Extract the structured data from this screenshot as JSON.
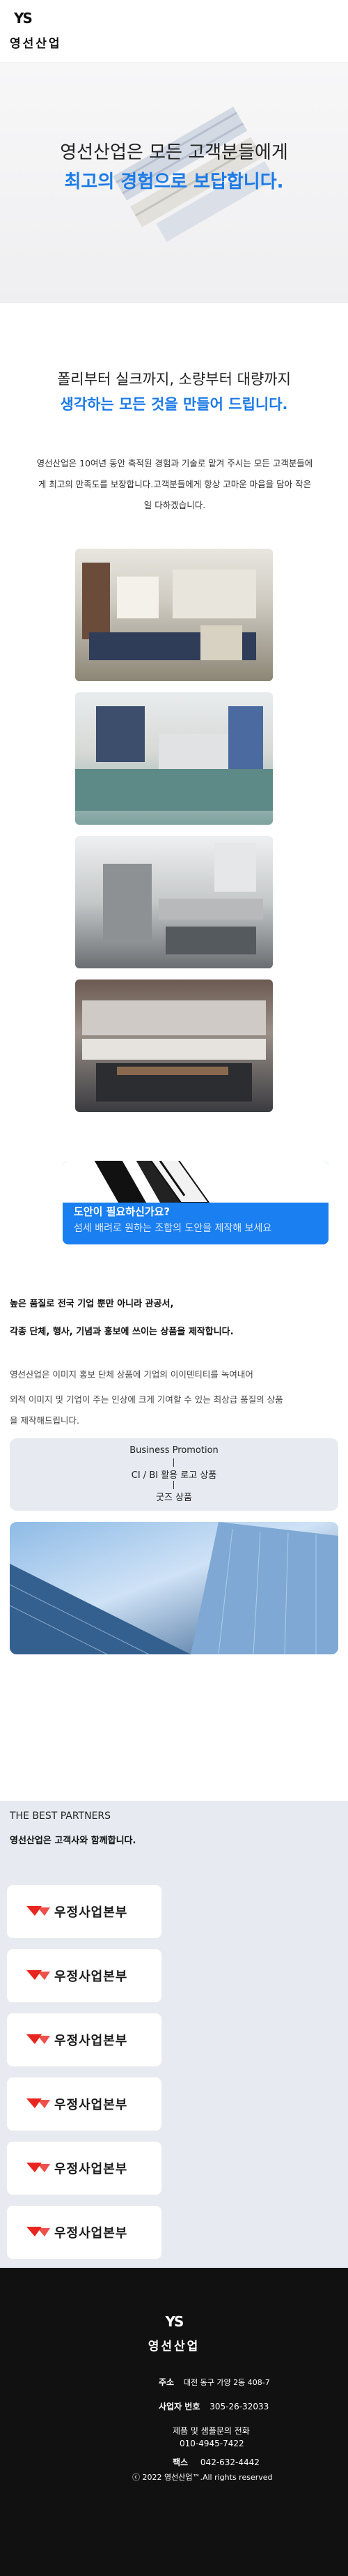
{
  "header": {
    "logo_mark": "YS",
    "company_name": "영선산업"
  },
  "hero": {
    "line1": "영선산업은 모든 고객분들에게",
    "line2": "최고의 경험으로 보답합니다."
  },
  "intro": {
    "line1": "폴리부터 실크까지, 소량부터 대량까지",
    "line2": "생각하는 모든 것을 만들어 드립니다.",
    "para1": "영선산업은 10여년 동안 축적된 경험과 기술로 맡겨 주시는 모든 고객분들에",
    "para2": "게 최고의 만족도를 보장합니다.고객분들에게 항상 고마운 마음을 담아 작은",
    "para3": "일 다하겠습니다."
  },
  "cta": {
    "question": "도안이 필요하신가요?",
    "desc": "섬세 배려로 원하는 조합의 도안을 제작해 보세요"
  },
  "promo": {
    "line1": "높은 품질로 전국 기업 뿐만 아니라 관공서,",
    "line2": "각종 단체, 행사, 기념과 홍보에 쓰이는 상품을 제작합니다.",
    "para1": "영선산업은 이미지 홍보 단체 상품에 기업의 이이덴티티를 녹여내어",
    "para2": "외적 이미지 및 기업이 주는 인상에 크게 기여할 수 있는 최상급 품질의 상품",
    "para3": "을 제작해드립니다."
  },
  "diagram": {
    "top": "Business Promotion",
    "middle": "CI / BI 활용 로고 상품",
    "bottom": "굿즈 상품"
  },
  "partners": {
    "title": "THE BEST PARTNERS",
    "subtitle": "영선산업은 고객사와 함께합니다.",
    "items": [
      {
        "name": "우정사업본부"
      },
      {
        "name": "우정사업본부"
      },
      {
        "name": "우정사업본부"
      },
      {
        "name": "우정사업본부"
      },
      {
        "name": "우정사업본부"
      },
      {
        "name": "우정사업본부"
      }
    ]
  },
  "footer": {
    "logo_mark": "YS",
    "company_name": "영선산업",
    "address_label": "주소",
    "address_value": "대전 동구 가양 2동 408-7",
    "biz_label": "사업자 번호",
    "biz_value": "305-26-32033",
    "phone_label": "제품 및 샘플문의 전화",
    "phone_value": "010-4945-7422",
    "fax_label": "팩스",
    "fax_value": "042-632-4442",
    "copyright": "ⓒ 2022 영선산업™.All rights reserved"
  },
  "colors": {
    "accent": "#1c7be6",
    "cta": "#1a7ff0",
    "footer_bg": "#111111",
    "partners_bg": "#e7ebf1"
  }
}
